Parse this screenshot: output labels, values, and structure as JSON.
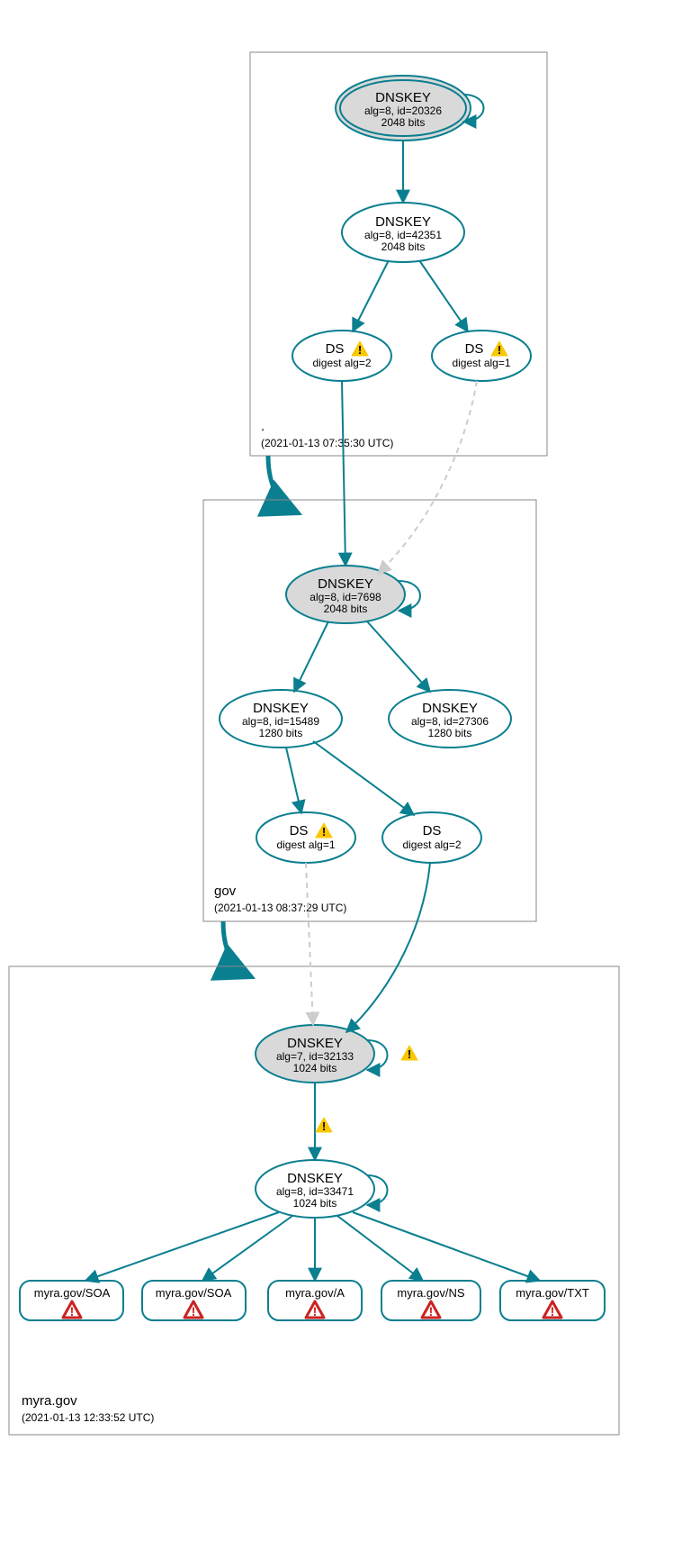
{
  "zones": {
    "root": {
      "name": ".",
      "timestamp": "(2021-01-13 07:35:30 UTC)"
    },
    "gov": {
      "name": "gov",
      "timestamp": "(2021-01-13 08:37:29 UTC)"
    },
    "myra": {
      "name": "myra.gov",
      "timestamp": "(2021-01-13 12:33:52 UTC)"
    }
  },
  "nodes": {
    "ksk_root": {
      "title": "DNSKEY",
      "l2": "alg=8, id=20326",
      "l3": "2048 bits"
    },
    "zsk_root": {
      "title": "DNSKEY",
      "l2": "alg=8, id=42351",
      "l3": "2048 bits"
    },
    "ds_root_2": {
      "title": "DS",
      "l2": "digest alg=2"
    },
    "ds_root_1": {
      "title": "DS",
      "l2": "digest alg=1"
    },
    "ksk_gov": {
      "title": "DNSKEY",
      "l2": "alg=8, id=7698",
      "l3": "2048 bits"
    },
    "zsk_gov_a": {
      "title": "DNSKEY",
      "l2": "alg=8, id=15489",
      "l3": "1280 bits"
    },
    "zsk_gov_b": {
      "title": "DNSKEY",
      "l2": "alg=8, id=27306",
      "l3": "1280 bits"
    },
    "ds_gov_1": {
      "title": "DS",
      "l2": "digest alg=1"
    },
    "ds_gov_2": {
      "title": "DS",
      "l2": "digest alg=2"
    },
    "ksk_myra": {
      "title": "DNSKEY",
      "l2": "alg=7, id=32133",
      "l3": "1024 bits"
    },
    "zsk_myra": {
      "title": "DNSKEY",
      "l2": "alg=8, id=33471",
      "l3": "1024 bits"
    }
  },
  "records": {
    "r1": "myra.gov/SOA",
    "r2": "myra.gov/SOA",
    "r3": "myra.gov/A",
    "r4": "myra.gov/NS",
    "r5": "myra.gov/TXT"
  }
}
